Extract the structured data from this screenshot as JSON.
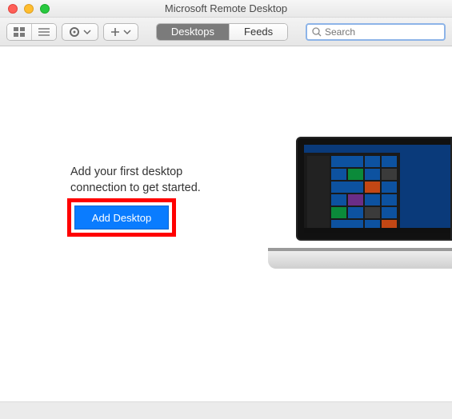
{
  "window": {
    "title": "Microsoft Remote Desktop"
  },
  "toolbar": {
    "tabs": {
      "desktops": "Desktops",
      "feeds": "Feeds"
    },
    "search": {
      "placeholder": "Search",
      "value": ""
    }
  },
  "empty": {
    "message": "Add your first desktop connection to get started.",
    "button": "Add Desktop"
  },
  "icons": {
    "grid": "grid-icon",
    "list": "list-icon",
    "gear": "gear-icon",
    "chevron": "chevron-down-icon",
    "plus": "plus-icon",
    "search": "search-icon"
  }
}
